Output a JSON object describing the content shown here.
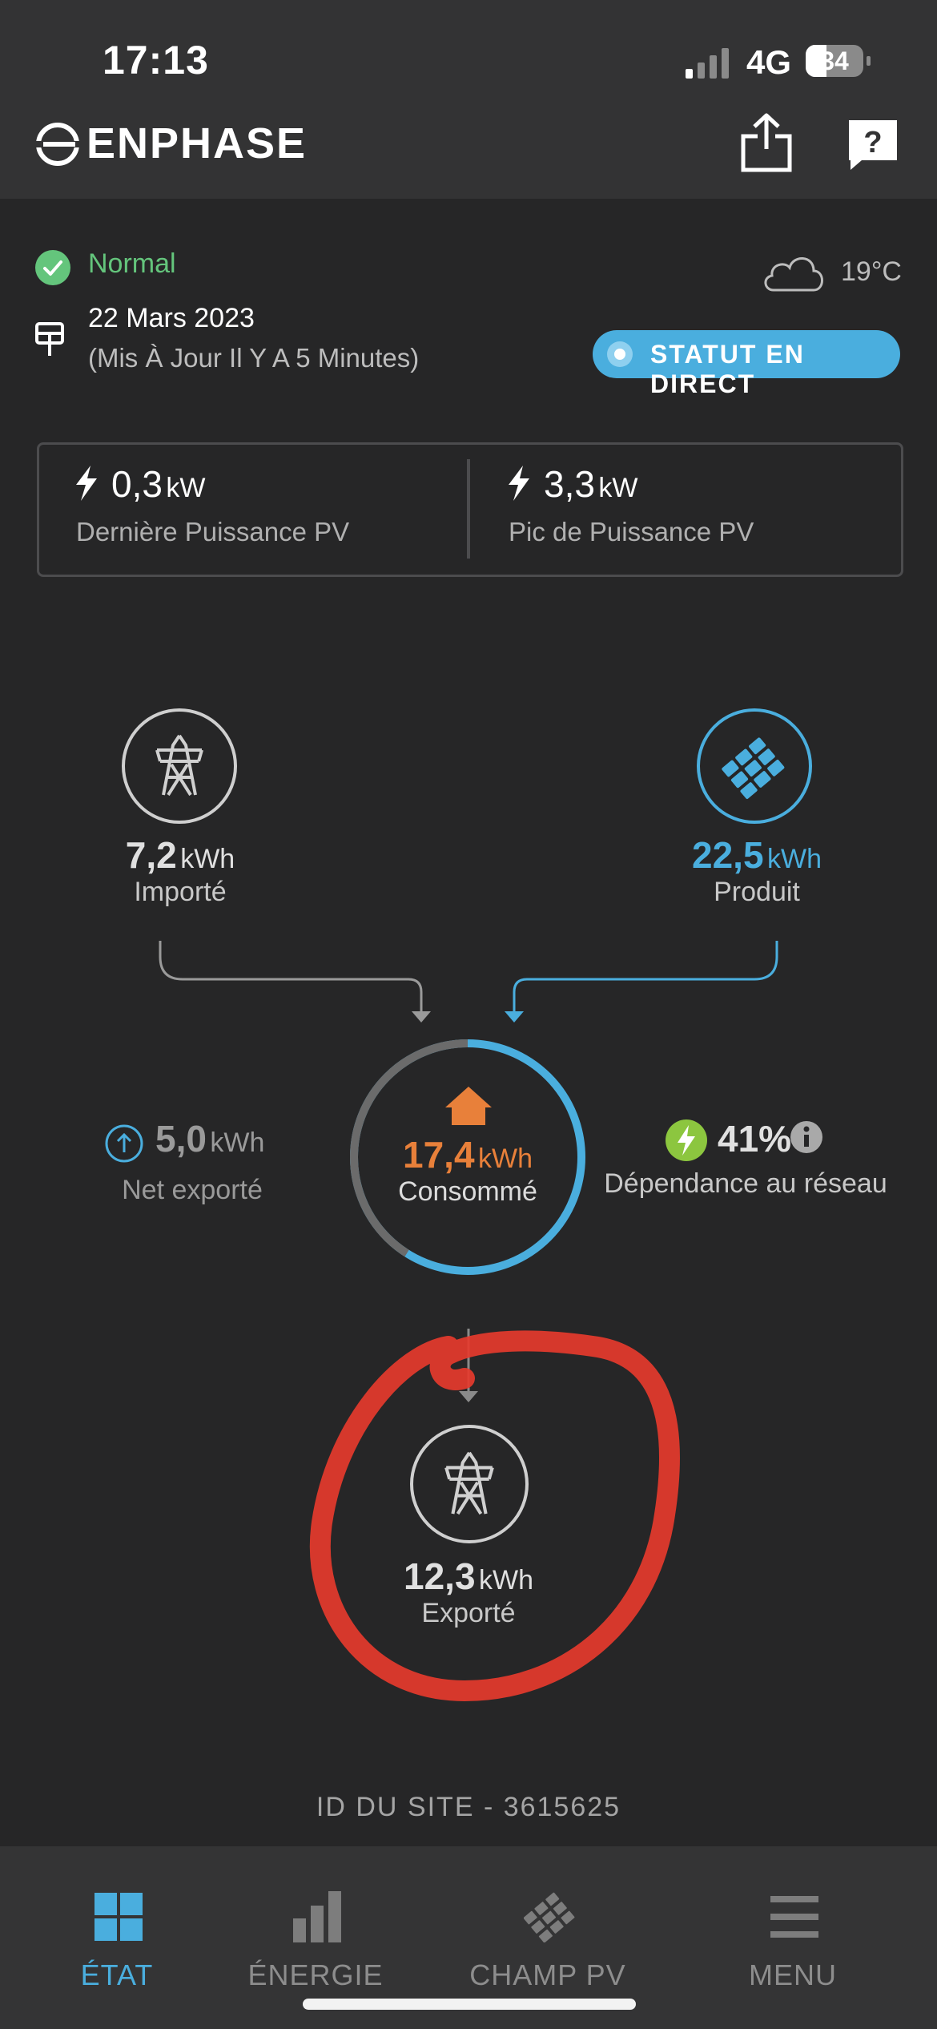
{
  "status_bar": {
    "time": "17:13",
    "network": "4G",
    "battery": "34"
  },
  "header": {
    "brand": "ENPHASE",
    "icons": {
      "logo": "enphase-logo-icon",
      "share": "share-icon",
      "help": "help-icon"
    }
  },
  "system_status": {
    "status": "Normal",
    "date": "22 Mars 2023",
    "updated": "(Mis À Jour Il Y A 5 Minutes)",
    "temperature": "19°C",
    "live_button": "STATUT EN DIRECT"
  },
  "power": {
    "latest": {
      "value": "0,3",
      "unit": "kW",
      "label": "Dernière Puissance PV"
    },
    "peak": {
      "value": "3,3",
      "unit": "kW",
      "label": "Pic de Puissance PV"
    }
  },
  "energy": {
    "imported": {
      "value": "7,2",
      "unit": "kWh",
      "label": "Importé"
    },
    "produced": {
      "value": "22,5",
      "unit": "kWh",
      "label": "Produit"
    },
    "consumed": {
      "value": "17,4",
      "unit": "kWh",
      "label": "Consommé"
    },
    "net_exported": {
      "value": "5,0",
      "unit": "kWh",
      "label": "Net exporté"
    },
    "grid_dependency": {
      "value": "41%",
      "label": "Dépendance au réseau"
    },
    "exported": {
      "value": "12,3",
      "unit": "kWh",
      "label": "Exporté"
    },
    "consumption_from_grid_fraction": 0.41
  },
  "site_id": "ID DU SITE - 3615625",
  "tabs": [
    {
      "label": "ÉTAT",
      "icon": "dashboard-icon",
      "active": true
    },
    {
      "label": "ÉNERGIE",
      "icon": "bar-chart-icon",
      "active": false
    },
    {
      "label": "CHAMP PV",
      "icon": "solar-panel-icon",
      "active": false
    },
    {
      "label": "MENU",
      "icon": "menu-icon",
      "active": false
    }
  ],
  "colors": {
    "background": "#262627",
    "header": "#333334",
    "accent_blue": "#4aaede",
    "consumption_orange": "#e8803a",
    "status_green": "#64c57c",
    "dependency_green": "#8cc63f",
    "annotation_red": "#e53a2c"
  }
}
